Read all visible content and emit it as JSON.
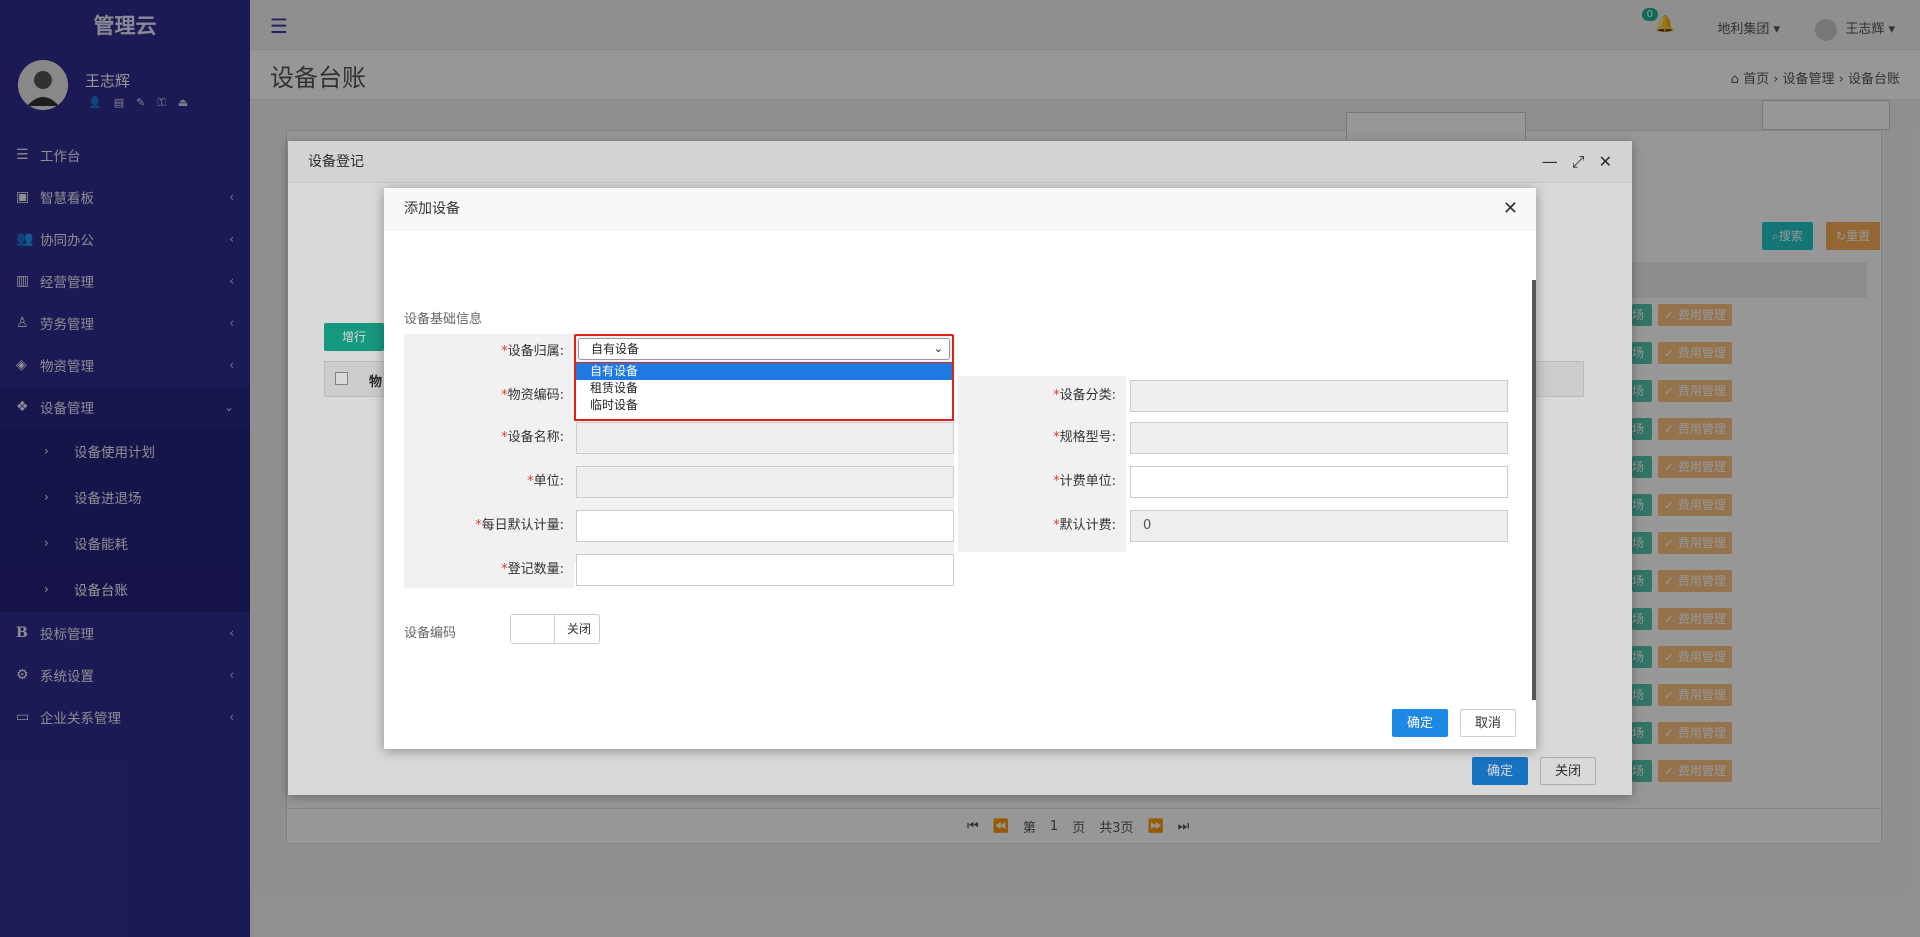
{
  "brand": "管理云",
  "user": {
    "name": "王志辉"
  },
  "sidebar": {
    "items": [
      {
        "label": "工作台",
        "icon": "list-icon"
      },
      {
        "label": "智慧看板",
        "icon": "dashboard-icon"
      },
      {
        "label": "协同办公",
        "icon": "users-icon"
      },
      {
        "label": "经营管理",
        "icon": "bar-chart-icon"
      },
      {
        "label": "劳务管理",
        "icon": "worker-icon"
      },
      {
        "label": "物资管理",
        "icon": "cube-icon"
      },
      {
        "label": "设备管理",
        "icon": "cubes-icon"
      }
    ],
    "subitems": [
      {
        "label": "设备使用计划"
      },
      {
        "label": "设备进退场"
      },
      {
        "label": "设备能耗"
      },
      {
        "label": "设备台账"
      }
    ],
    "items2": [
      {
        "label": "投标管理",
        "icon": "bold-b-icon"
      },
      {
        "label": "系统设置",
        "icon": "gear-icon"
      },
      {
        "label": "企业关系管理",
        "icon": "monitor-icon"
      }
    ]
  },
  "topbar": {
    "badge": "0",
    "org": "地利集团",
    "user": "王志辉"
  },
  "page": {
    "title": "设备台账",
    "breadcrumb": "首页 › 设备管理 › 设备台账"
  },
  "bg": {
    "search": "搜索",
    "reset": "重置",
    "addrow": "增行",
    "fee": "费用管理",
    "del": "除",
    "field": "场",
    "col_head": "物",
    "pager": {
      "page": "第",
      "num": "1",
      "unit": "页",
      "total": "共3页"
    }
  },
  "dialog1": {
    "title": "设备登记",
    "ok": "确定",
    "close": "关闭"
  },
  "dialog2": {
    "title": "添加设备",
    "section": "设备基础信息",
    "fields": {
      "belong": "设备归属:",
      "material_code": "物资编码:",
      "name": "设备名称:",
      "unit": "单位:",
      "daily": "每日默认计量:",
      "count": "登记数量:",
      "category": "设备分类:",
      "spec": "规格型号:",
      "fee_unit": "计费单位:",
      "default_fee": "默认计费:"
    },
    "default_fee_value": "0",
    "select": {
      "value": "自有设备",
      "options": [
        "自有设备",
        "租赁设备",
        "临时设备"
      ]
    },
    "code_label": "设备编码",
    "switch_label": "关闭",
    "ok": "确定",
    "cancel": "取消"
  }
}
